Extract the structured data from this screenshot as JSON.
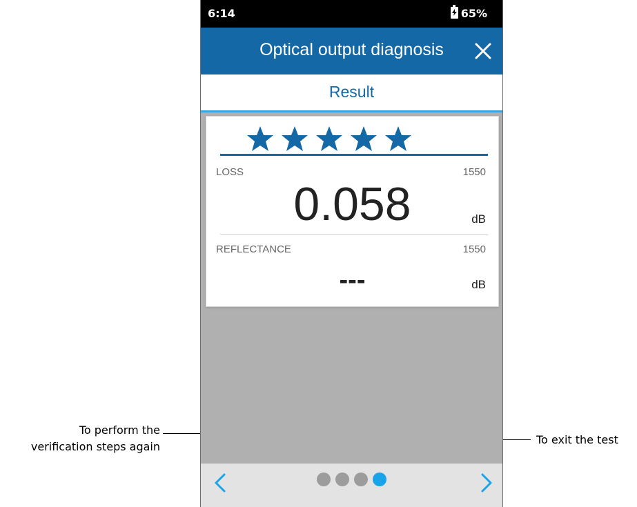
{
  "status_bar": {
    "time": "6:14",
    "battery_percent": "65%"
  },
  "app_bar": {
    "title": "Optical output diagnosis",
    "close_icon": "close-icon"
  },
  "tabs": {
    "active_tab": "Result"
  },
  "result_card": {
    "rating_stars": 5,
    "rating_max": 5,
    "loss": {
      "label": "LOSS",
      "wavelength": "1550",
      "value": "0.058",
      "unit": "dB"
    },
    "reflectance": {
      "label": "REFLECTANCE",
      "wavelength": "1550",
      "value": "---",
      "unit": "dB"
    }
  },
  "bottom_nav": {
    "page_count": 4,
    "active_page": 4,
    "prev_icon": "chevron-left-icon",
    "next_icon": "chevron-right-icon"
  },
  "annotations": {
    "left_line1": "To perform the",
    "left_line2": "verification steps again",
    "right": "To exit the test"
  },
  "colors": {
    "app_bar": "#1468a6",
    "accent": "#1aa3e8",
    "content_bg": "#b0b0b0"
  }
}
